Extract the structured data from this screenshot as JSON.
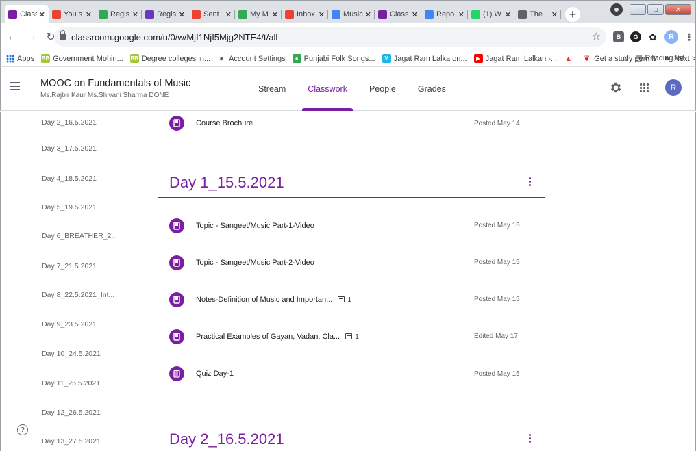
{
  "browser": {
    "tabs": [
      {
        "title": "Class",
        "favicon": "classroom",
        "color": "#7b1fa2",
        "active": true
      },
      {
        "title": "You s",
        "favicon": "gmail",
        "color": "#ea4335"
      },
      {
        "title": "Regis",
        "favicon": "drive",
        "color": "#34a853"
      },
      {
        "title": "Regis",
        "favicon": "forms",
        "color": "#673ab7"
      },
      {
        "title": "Sent",
        "favicon": "gmail",
        "color": "#ea4335"
      },
      {
        "title": "My M",
        "favicon": "drive",
        "color": "#34a853"
      },
      {
        "title": "Inbox",
        "favicon": "gmail",
        "color": "#ea4335"
      },
      {
        "title": "Music",
        "favicon": "docs",
        "color": "#4285f4"
      },
      {
        "title": "Class",
        "favicon": "classroom",
        "color": "#7b1fa2"
      },
      {
        "title": "Repo",
        "favicon": "docs",
        "color": "#4285f4"
      },
      {
        "title": "(1) W",
        "favicon": "whatsapp",
        "color": "#25d366"
      },
      {
        "title": "The",
        "favicon": "tribune",
        "color": "#5f6368"
      }
    ],
    "new_tab_symbol": "+",
    "url": "classroom.google.com/u/0/w/MjI1NjI5Mjg2NTE4/t/all",
    "profile_initial": "R",
    "extensions": [
      "B",
      "G",
      "✿"
    ],
    "bookmarks": [
      {
        "label": "Apps",
        "icon": "apps-icon"
      },
      {
        "label": "Government Mohin...",
        "icon": "bb-icon",
        "badge": "BB",
        "color": "#a4c639"
      },
      {
        "label": "Degree colleges in...",
        "icon": "bb-icon",
        "badge": "BB",
        "color": "#a4c639"
      },
      {
        "label": "Account Settings",
        "icon": "globe-icon",
        "badge": "●",
        "color": "#5f6368"
      },
      {
        "label": "Punjabi Folk Songs...",
        "icon": "leaf-icon",
        "badge": "●",
        "color": "#34a853"
      },
      {
        "label": "Jagat Ram Lalka on...",
        "icon": "vimeo-icon",
        "badge": "V",
        "color": "#1ab7ea"
      },
      {
        "label": "Jagat Ram Lalkan -...",
        "icon": "youtube-icon",
        "badge": "▶",
        "color": "#ff0000"
      },
      {
        "label": "",
        "icon": "triangle-icon",
        "badge": "▲",
        "color": "#e53935"
      },
      {
        "label": "Get a study permit",
        "icon": "maple-leaf-icon",
        "badge": "❦",
        "color": "#d32f2f"
      },
      {
        "label": "Next >>",
        "icon": "globe-icon",
        "badge": "●",
        "color": "#5f6368"
      }
    ],
    "bookmarks_overflow": "»",
    "reading_list": "Reading list"
  },
  "header": {
    "class_title": "MOOC on Fundamentals of Music",
    "class_subtitle": "Ms.Rajbir Kaur Ms.Shivani Sharma DONE",
    "tabs": [
      {
        "label": "Stream",
        "active": false
      },
      {
        "label": "Classwork",
        "active": true
      },
      {
        "label": "People",
        "active": false
      },
      {
        "label": "Grades",
        "active": false
      }
    ],
    "avatar_initial": "R"
  },
  "sidebar": {
    "items": [
      "Day 2_16.5.2021",
      "Day 3_17.5.2021",
      "Day 4_18.5.2021",
      "Day 5_19.5.2021",
      "Day 6_BREATHER_2...",
      "Day 7_21.5.2021",
      "Day 8_22.5.2021_Int...",
      "Day 9_23.5.2021",
      "Day 10_24.5.2021",
      "Day 11_25.5.2021",
      "Day 12_26.5.2021",
      "Day 13_27.5.2021"
    ],
    "help_symbol": "?"
  },
  "classwork": {
    "top_item": {
      "title": "Course Brochure",
      "date": "Posted May 14",
      "type": "material"
    },
    "topics": [
      {
        "title": "Day 1_15.5.2021",
        "items": [
          {
            "title": "Topic - Sangeet/Music Part-1-Video",
            "date": "Posted May 15",
            "type": "material",
            "comments": ""
          },
          {
            "title": "Topic - Sangeet/Music Part-2-Video",
            "date": "Posted May 15",
            "type": "material",
            "comments": ""
          },
          {
            "title": "Notes-Definition of Music and Importan...",
            "date": "Posted May 15",
            "type": "material",
            "comments": "1"
          },
          {
            "title": "Practical Examples of Gayan, Vadan, Cla...",
            "date": "Edited May 17",
            "type": "material",
            "comments": "1"
          },
          {
            "title": "Quiz Day-1",
            "date": "Posted May 15",
            "type": "quiz",
            "comments": ""
          }
        ]
      },
      {
        "title": "Day 2_16.5.2021",
        "items": []
      }
    ]
  },
  "colors": {
    "accent": "#7b1fa2",
    "text_secondary": "#5f6368",
    "divider": "#dadce0"
  }
}
